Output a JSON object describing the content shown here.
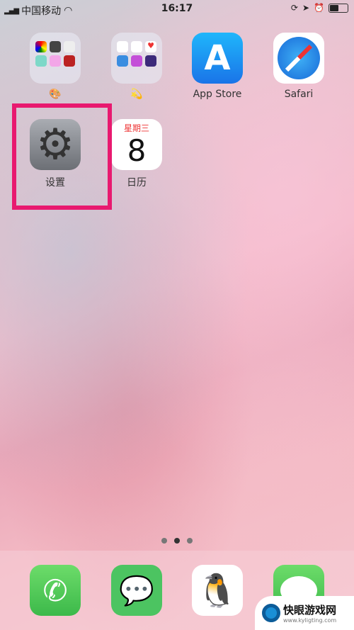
{
  "status_bar": {
    "carrier": "中国移动",
    "time": "16:17",
    "battery_percent": 50
  },
  "home": {
    "apps": [
      {
        "name": "folder-1",
        "label": "🎨",
        "type": "folder"
      },
      {
        "name": "folder-2",
        "label": "💫",
        "type": "folder"
      },
      {
        "name": "app-store",
        "label": "App Store"
      },
      {
        "name": "safari",
        "label": "Safari"
      },
      {
        "name": "settings",
        "label": "设置"
      },
      {
        "name": "calendar",
        "label": "日历",
        "weekday": "星期三",
        "day": "8"
      }
    ],
    "page_count": 3,
    "current_page": 2
  },
  "dock": {
    "apps": [
      "Phone",
      "WeChat",
      "QQ",
      "Messages"
    ]
  },
  "watermark": {
    "title": "快眼游戏网",
    "url": "www.kyligting.com"
  },
  "colors": {
    "highlight": "#e8196f"
  }
}
